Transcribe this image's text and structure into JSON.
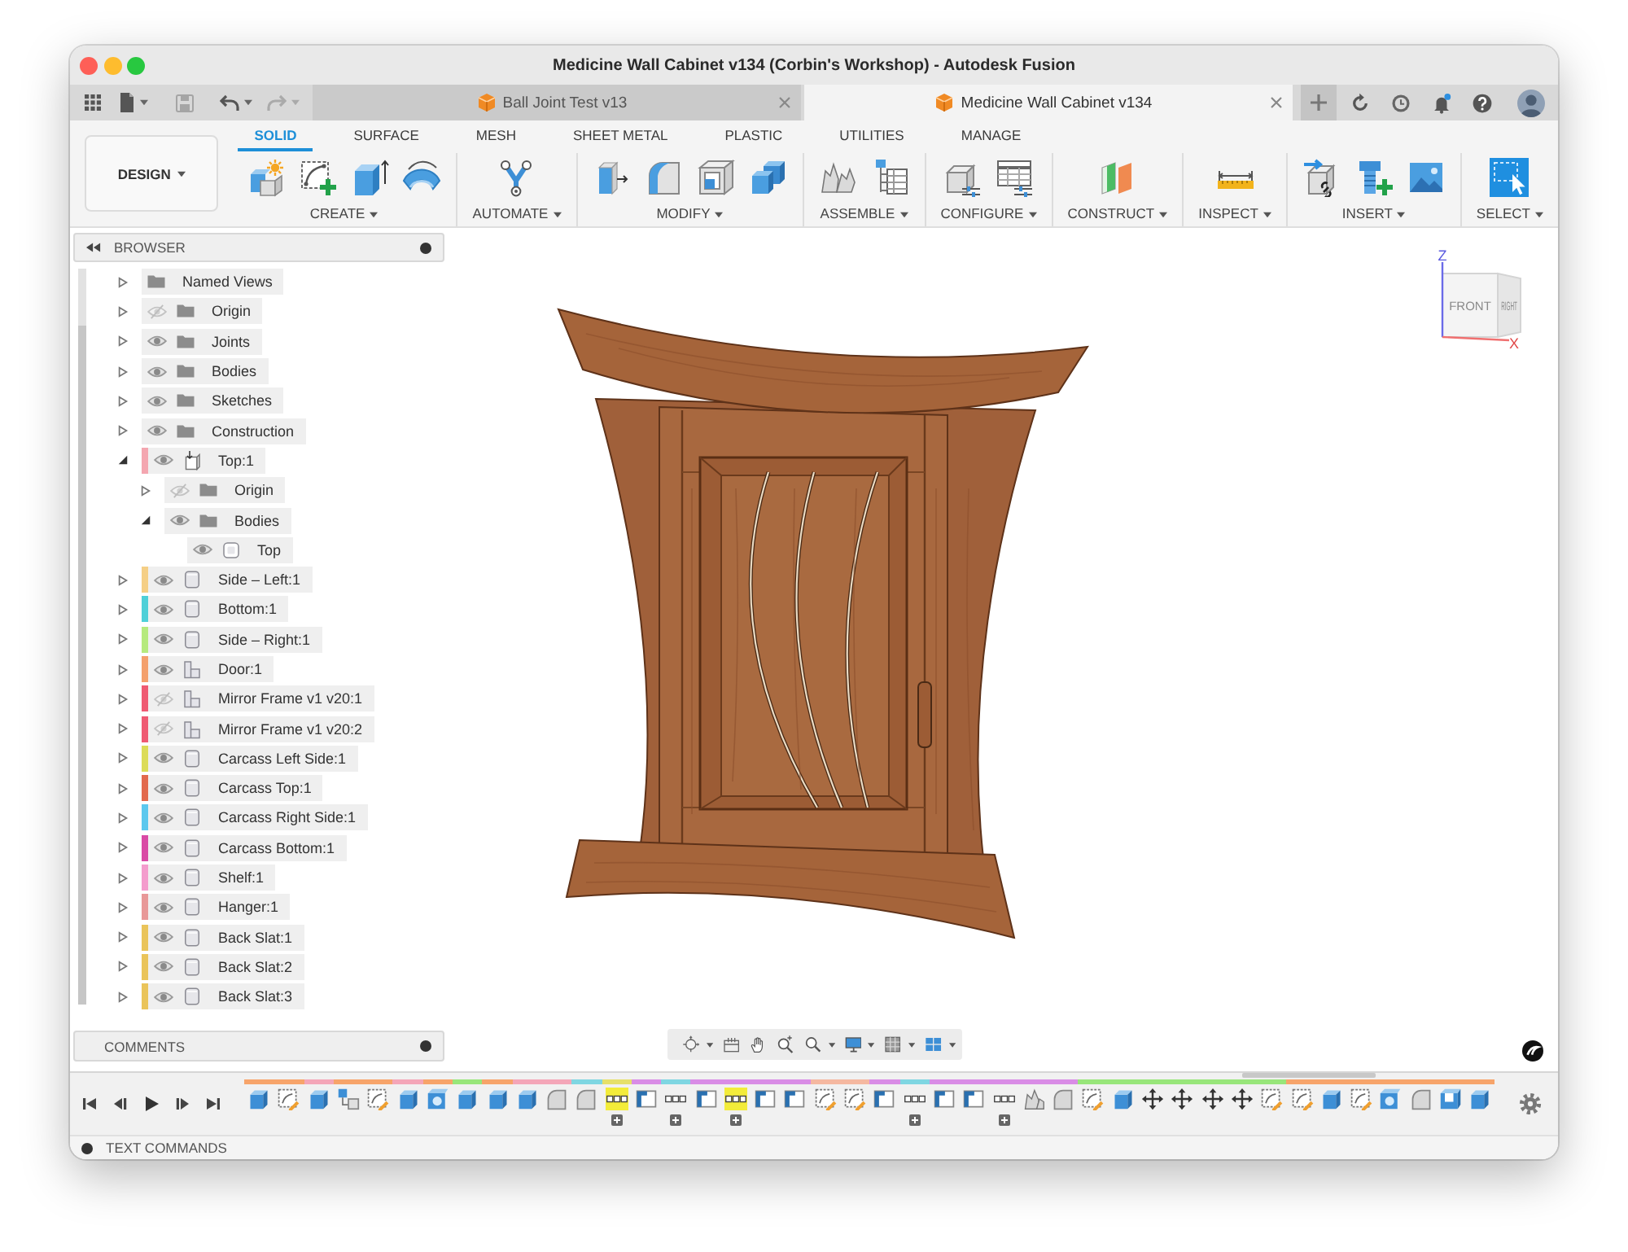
{
  "window": {
    "title": "Medicine Wall Cabinet v134 (Corbin's Workshop) - Autodesk Fusion"
  },
  "document_tabs": [
    {
      "label": "Ball Joint Test v13",
      "selected": false
    },
    {
      "label": "Medicine Wall Cabinet v134",
      "selected": true
    }
  ],
  "toolbar": {
    "workspace": "DESIGN",
    "tabs": [
      {
        "label": "SOLID",
        "selected": true
      },
      {
        "label": "SURFACE",
        "selected": false
      },
      {
        "label": "MESH",
        "selected": false
      },
      {
        "label": "SHEET METAL",
        "selected": false
      },
      {
        "label": "PLASTIC",
        "selected": false
      },
      {
        "label": "UTILITIES",
        "selected": false
      },
      {
        "label": "MANAGE",
        "selected": false
      }
    ],
    "groups": [
      {
        "label": "CREATE",
        "tools": [
          {
            "kind": "new-component"
          },
          {
            "kind": "sketch"
          },
          {
            "kind": "extrude"
          },
          {
            "kind": "revolve"
          }
        ]
      },
      {
        "label": "AUTOMATE",
        "tools": [
          {
            "kind": "automate"
          }
        ]
      },
      {
        "label": "MODIFY",
        "tools": [
          {
            "kind": "press-pull"
          },
          {
            "kind": "fillet"
          },
          {
            "kind": "shell"
          },
          {
            "kind": "combine"
          }
        ]
      },
      {
        "label": "ASSEMBLE",
        "tools": [
          {
            "kind": "joint"
          },
          {
            "kind": "component-table"
          }
        ]
      },
      {
        "label": "CONFIGURE",
        "tools": [
          {
            "kind": "configure"
          },
          {
            "kind": "configure-table"
          }
        ]
      },
      {
        "label": "CONSTRUCT",
        "tools": [
          {
            "kind": "construct"
          }
        ]
      },
      {
        "label": "INSPECT",
        "tools": [
          {
            "kind": "measure"
          }
        ]
      },
      {
        "label": "INSERT",
        "tools": [
          {
            "kind": "insert-derive"
          },
          {
            "kind": "insert-part"
          },
          {
            "kind": "insert-image"
          }
        ]
      },
      {
        "label": "SELECT",
        "tools": [
          {
            "kind": "select"
          }
        ]
      }
    ]
  },
  "browser": {
    "title": "BROWSER",
    "items": [
      {
        "label": "Named Views",
        "kind": "folder",
        "expanded": false
      },
      {
        "label": "Origin",
        "kind": "folder",
        "expanded": false,
        "visible": false
      },
      {
        "label": "Joints",
        "kind": "folder",
        "expanded": false,
        "visible": true
      },
      {
        "label": "Bodies",
        "kind": "folder",
        "expanded": false,
        "visible": true
      },
      {
        "label": "Sketches",
        "kind": "folder",
        "expanded": false,
        "visible": true
      },
      {
        "label": "Construction",
        "kind": "folder",
        "expanded": false,
        "visible": true
      },
      {
        "label": "Top:1",
        "kind": "active-component",
        "expanded": true,
        "visible": true,
        "color": "#f4a6b0",
        "children": [
          {
            "label": "Origin",
            "kind": "folder",
            "expanded": false,
            "visible": false
          },
          {
            "label": "Bodies",
            "kind": "folder",
            "expanded": true,
            "visible": true,
            "children": [
              {
                "label": "Top",
                "kind": "body",
                "visible": true
              }
            ]
          }
        ]
      },
      {
        "label": "Side – Left:1",
        "kind": "component",
        "expanded": false,
        "visible": true,
        "color": "#f5cf86"
      },
      {
        "label": "Bottom:1",
        "kind": "component",
        "expanded": false,
        "visible": true,
        "color": "#4fd0d8"
      },
      {
        "label": "Side – Right:1",
        "kind": "component",
        "expanded": false,
        "visible": true,
        "color": "#b6ea7e"
      },
      {
        "label": "Door:1",
        "kind": "assembly",
        "expanded": false,
        "visible": true,
        "color": "#f4a06c"
      },
      {
        "label": "Mirror Frame v1 v20:1",
        "kind": "assembly",
        "expanded": false,
        "visible": false,
        "color": "#ef5a72"
      },
      {
        "label": "Mirror Frame v1 v20:2",
        "kind": "assembly",
        "expanded": false,
        "visible": false,
        "color": "#ef5a72"
      },
      {
        "label": "Carcass Left Side:1",
        "kind": "component",
        "expanded": false,
        "visible": true,
        "color": "#dcdc58"
      },
      {
        "label": "Carcass Top:1",
        "kind": "component",
        "expanded": false,
        "visible": true,
        "color": "#e2694d"
      },
      {
        "label": "Carcass Right Side:1",
        "kind": "component",
        "expanded": false,
        "visible": true,
        "color": "#5cc8ee"
      },
      {
        "label": "Carcass Bottom:1",
        "kind": "component",
        "expanded": false,
        "visible": true,
        "color": "#d94aa5"
      },
      {
        "label": "Shelf:1",
        "kind": "component",
        "expanded": false,
        "visible": true,
        "color": "#f49ccd"
      },
      {
        "label": "Hanger:1",
        "kind": "component",
        "expanded": false,
        "visible": true,
        "color": "#e89898"
      },
      {
        "label": "Back Slat:1",
        "kind": "component",
        "expanded": false,
        "visible": true,
        "color": "#eac45a"
      },
      {
        "label": "Back Slat:2",
        "kind": "component",
        "expanded": false,
        "visible": true,
        "color": "#eac45a"
      },
      {
        "label": "Back Slat:3",
        "kind": "component",
        "expanded": false,
        "visible": true,
        "color": "#eac45a"
      }
    ]
  },
  "comments": {
    "title": "COMMENTS"
  },
  "viewcube": {
    "front": "FRONT",
    "right": "RIGHT",
    "axis_z": "Z",
    "axis_x": "X"
  },
  "timeline": {
    "features": [
      {
        "kind": "extrude",
        "color": "#f7a46a",
        "selected": false
      },
      {
        "kind": "sketch",
        "color": "#f7a46a",
        "selected": false
      },
      {
        "kind": "extrude",
        "color": "#f4a6b8",
        "selected": false
      },
      {
        "kind": "component",
        "color": "#f7a46a",
        "selected": false
      },
      {
        "kind": "sketch",
        "color": "#f7a46a",
        "selected": false
      },
      {
        "kind": "extrude",
        "color": "#f4a6b8",
        "selected": false
      },
      {
        "kind": "combine",
        "color": "#f7a46a",
        "selected": false
      },
      {
        "kind": "extrude",
        "color": "#98e67a",
        "selected": false
      },
      {
        "kind": "extrude",
        "color": "#f7a46a",
        "selected": false
      },
      {
        "kind": "extrude",
        "color": "#f4a6b8",
        "selected": false
      },
      {
        "kind": "fillet",
        "color": "#f4a6b8",
        "selected": false
      },
      {
        "kind": "fillet",
        "color": "#7fd6e2",
        "selected": false
      },
      {
        "kind": "group",
        "color": "#e6e06a",
        "selected": true
      },
      {
        "kind": "plane",
        "color": "#d98ce6",
        "selected": false
      },
      {
        "kind": "group",
        "color": "#7fd6e2",
        "selected": false
      },
      {
        "kind": "plane",
        "color": "#d98ce6",
        "selected": false
      },
      {
        "kind": "group",
        "color": "#d98ce6",
        "selected": true
      },
      {
        "kind": "plane",
        "color": "#d98ce6",
        "selected": false
      },
      {
        "kind": "plane",
        "color": "#d98ce6",
        "selected": false
      },
      {
        "kind": "sketch",
        "color": "#f5b8a0",
        "selected": false
      },
      {
        "kind": "sketch",
        "color": "#f5b8a0",
        "selected": false
      },
      {
        "kind": "plane",
        "color": "#d98ce6",
        "selected": false
      },
      {
        "kind": "group",
        "color": "#7fd6e2",
        "selected": false
      },
      {
        "kind": "plane",
        "color": "#d98ce6",
        "selected": false
      },
      {
        "kind": "plane",
        "color": "#d98ce6",
        "selected": false
      },
      {
        "kind": "group",
        "color": "#d98ce6",
        "selected": false
      },
      {
        "kind": "joint",
        "color": "#d98ce6",
        "selected": false
      },
      {
        "kind": "fillet",
        "color": "#d98ce6",
        "selected": false
      },
      {
        "kind": "sketch",
        "color": "#98e67a",
        "selected": false
      },
      {
        "kind": "extrude",
        "color": "#98e67a",
        "selected": false
      },
      {
        "kind": "move",
        "color": "#98e67a",
        "selected": false
      },
      {
        "kind": "move",
        "color": "#98e67a",
        "selected": false
      },
      {
        "kind": "move",
        "color": "#98e67a",
        "selected": false
      },
      {
        "kind": "move",
        "color": "#98e67a",
        "selected": false
      },
      {
        "kind": "sketch",
        "color": "#98e67a",
        "selected": false
      },
      {
        "kind": "sketch",
        "color": "#f7a46a",
        "selected": false
      },
      {
        "kind": "extrude",
        "color": "#f7a46a",
        "selected": false
      },
      {
        "kind": "sketch",
        "color": "#f7a46a",
        "selected": false
      },
      {
        "kind": "combine",
        "color": "#f7a46a",
        "selected": false
      },
      {
        "kind": "fillet",
        "color": "#f7a46a",
        "selected": false
      },
      {
        "kind": "shell",
        "color": "#f7a46a",
        "selected": false
      },
      {
        "kind": "extrude",
        "color": "#f7a46a",
        "selected": false
      }
    ]
  },
  "text_commands": {
    "title": "TEXT COMMANDS"
  }
}
